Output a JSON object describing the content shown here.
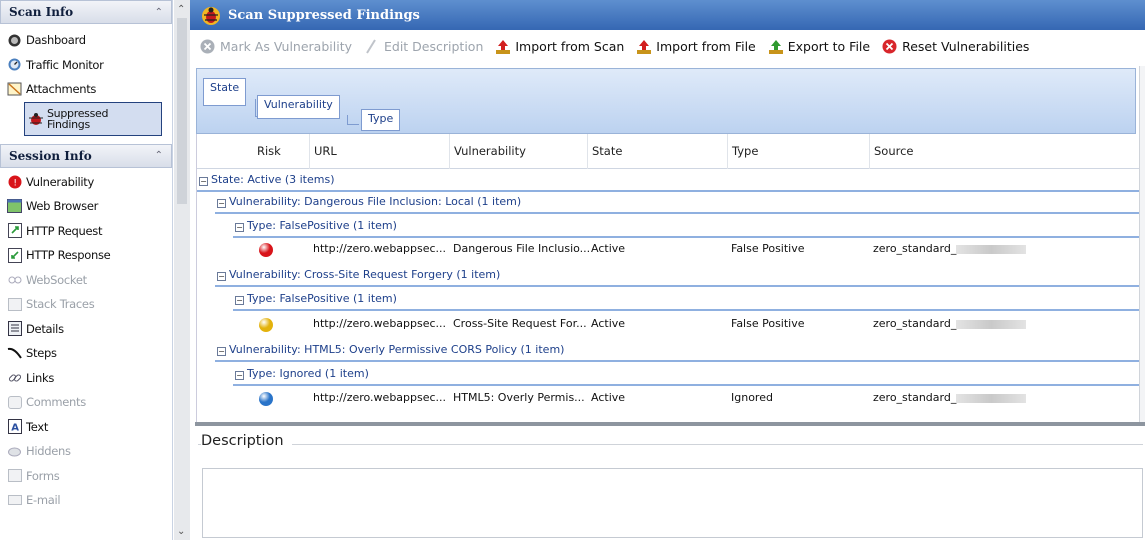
{
  "left_pane": {
    "scan_info": {
      "title": "Scan Info",
      "items": [
        {
          "label": "Dashboard",
          "icon": "dashboard-icon"
        },
        {
          "label": "Traffic Monitor",
          "icon": "traffic-monitor-icon"
        },
        {
          "label": "Attachments",
          "icon": "attachments-icon"
        },
        {
          "label": "Suppressed Findings",
          "icon": "suppressed-findings-icon",
          "active": true
        }
      ]
    },
    "session_info": {
      "title": "Session Info",
      "items": [
        {
          "label": "Vulnerability",
          "icon": "vulnerability-icon"
        },
        {
          "label": "Web Browser",
          "icon": "web-browser-icon"
        },
        {
          "label": "HTTP Request",
          "icon": "http-request-icon"
        },
        {
          "label": "HTTP Response",
          "icon": "http-response-icon"
        },
        {
          "label": "WebSocket",
          "icon": "websocket-icon",
          "disabled": true
        },
        {
          "label": "Stack Traces",
          "icon": "stack-traces-icon",
          "disabled": true
        },
        {
          "label": "Details",
          "icon": "details-icon"
        },
        {
          "label": "Steps",
          "icon": "steps-icon"
        },
        {
          "label": "Links",
          "icon": "links-icon"
        },
        {
          "label": "Comments",
          "icon": "comments-icon",
          "disabled": true
        },
        {
          "label": "Text",
          "icon": "text-icon"
        },
        {
          "label": "Hiddens",
          "icon": "hiddens-icon",
          "disabled": true
        },
        {
          "label": "Forms",
          "icon": "forms-icon",
          "disabled": true
        },
        {
          "label": "E-mail",
          "icon": "email-icon",
          "disabled": true
        }
      ]
    }
  },
  "panel": {
    "title": "Scan Suppressed Findings"
  },
  "toolbar": {
    "mark_as_vulnerability": "Mark As Vulnerability",
    "edit_description": "Edit Description",
    "import_from_scan": "Import from Scan",
    "import_from_file": "Import from File",
    "export_to_file": "Export to File",
    "reset_vulnerabilities": "Reset Vulnerabilities"
  },
  "grouping": {
    "levels": [
      "State",
      "Vulnerability",
      "Type"
    ]
  },
  "table": {
    "columns": [
      "Risk",
      "URL",
      "Vulnerability",
      "State",
      "Type",
      "Source"
    ],
    "state_group": "State: Active (3 items)",
    "groups": [
      {
        "vulnerability": "Vulnerability: Dangerous File Inclusion: Local (1 item)",
        "type": "Type: FalsePositive (1 item)",
        "row": {
          "risk": "high",
          "risk_color": "#d8141a",
          "url": "http://zero.webappsec...",
          "vulnerability": "Dangerous File Inclusio...",
          "state": "Active",
          "type": "False Positive",
          "source": "zero_standard_"
        }
      },
      {
        "vulnerability": "Vulnerability: Cross-Site Request Forgery (1 item)",
        "type": "Type: FalsePositive (1 item)",
        "row": {
          "risk": "medium",
          "risk_color": "#e3b20c",
          "url": "http://zero.webappsec...",
          "vulnerability": "Cross-Site Request For...",
          "state": "Active",
          "type": "False Positive",
          "source": "zero_standard_"
        }
      },
      {
        "vulnerability": "Vulnerability: HTML5: Overly Permissive CORS Policy (1 item)",
        "type": "Type: Ignored (1 item)",
        "row": {
          "risk": "info",
          "risk_color": "#2a74c9",
          "url": "http://zero.webappsec...",
          "vulnerability": "HTML5: Overly Permis...",
          "state": "Active",
          "type": "Ignored",
          "source": "zero_standard_"
        }
      }
    ]
  },
  "description": {
    "label": "Description",
    "value": ""
  }
}
